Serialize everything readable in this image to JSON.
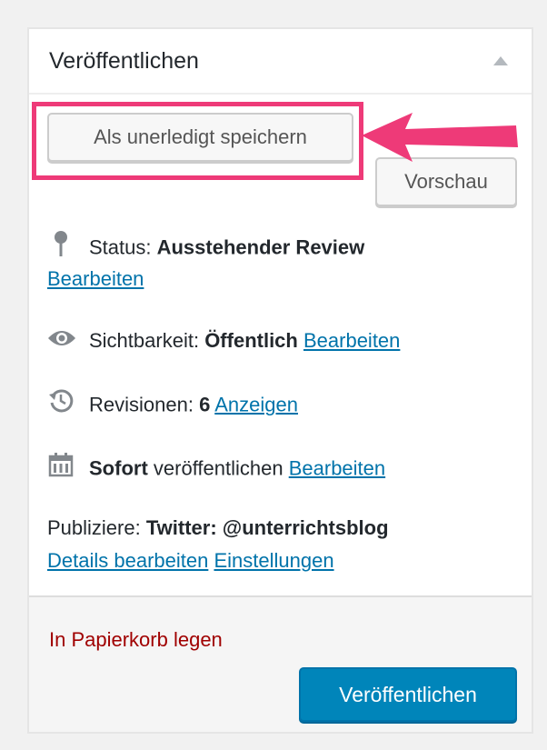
{
  "panel": {
    "title": "Veröffentlichen"
  },
  "actions": {
    "save_label": "Als unerledigt speichern",
    "preview_label": "Vorschau"
  },
  "status": {
    "label": "Status:",
    "value": "Ausstehender Review",
    "edit_link": "Bearbeiten",
    "icon": "pin-icon"
  },
  "visibility": {
    "label": "Sichtbarkeit:",
    "value": "Öffentlich",
    "edit_link": "Bearbeiten",
    "icon": "eye-icon"
  },
  "revisions": {
    "label": "Revisionen:",
    "count": "6",
    "view_link": "Anzeigen",
    "icon": "history-icon"
  },
  "schedule": {
    "value": "Sofort",
    "label": "veröffentlichen",
    "edit_link": "Bearbeiten",
    "icon": "calendar-icon"
  },
  "publicize": {
    "label": "Publiziere:",
    "value": "Twitter: @unterrichtsblog",
    "details_link": "Details bearbeiten",
    "settings_link": "Einstellungen"
  },
  "footer": {
    "trash_label": "In Papierkorb legen",
    "publish_label": "Veröffentlichen"
  },
  "colors": {
    "highlight": "#ee3a78",
    "link": "#0073aa",
    "trash": "#a00000",
    "primary": "#0085ba"
  }
}
